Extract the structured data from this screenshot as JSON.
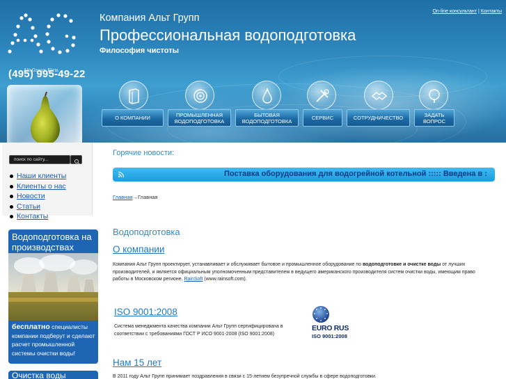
{
  "header": {
    "logo_letters": "AG",
    "logo_subtitle": "Alt Group Firm",
    "phone": "(495) 995-49-22",
    "company_name": "Компания Альт Групп",
    "site_title": "Профессиональная водоподготовка",
    "slogan": "Философия чистоты",
    "top_links": {
      "consultant": "On-line консультант",
      "separator": "|",
      "contacts": "Контакты"
    }
  },
  "nav": {
    "items": [
      {
        "label": "О компании",
        "icon": "book-icon"
      },
      {
        "label": "Промышленная водоподготовка",
        "icon": "disc-icon"
      },
      {
        "label": "Бытовая водоподготовка",
        "icon": "drop-icon"
      },
      {
        "label": "Сервис",
        "icon": "tools-icon"
      },
      {
        "label": "Сотрудничество",
        "icon": "handshake-icon"
      },
      {
        "label": "Задать вопрос",
        "icon": "question-icon"
      }
    ]
  },
  "sidebar": {
    "search_placeholder": "поиск по сайту...",
    "menu": [
      "Наши клиенты",
      "Клиенты о нас",
      "Новости",
      "Статьи",
      "Контакты"
    ],
    "promo": {
      "title": "Водоподготовка на производствах",
      "text_bold": "бесплатно",
      "text_rest": " специалисты компании подберут и сделают расчет промышленной системы очистки воды!"
    },
    "promo2_title": "Очистка воды"
  },
  "main": {
    "hot_news_label": "Горячие новости:",
    "ticker_text": "Поставка оборудования для водогрейной котельной ::::: Введена в :",
    "breadcrumb": {
      "home": "Главная",
      "arrow": "→",
      "current": "Главная"
    },
    "section_title": "Водоподготовка",
    "about": {
      "heading": "О компании",
      "text_1": "Компания Альт Групп проектирует, устанавливает и обслуживает бытовое и промышленное оборудование по ",
      "text_bold": "водоподготовке и очистке воды",
      "text_2": " от лучших производителей, и является официальным уполномоченным представителем в ведущего американского производителя систем очистки воды, имеющим право работы в Московском регионе. ",
      "link": "RainSoft",
      "text_3": " (www.rainsoft.com)."
    },
    "iso": {
      "heading": "ISO 9001:2008",
      "text": "Система менеджмента качества компании Альт Групп сертифицирована в соответствии с требованиями ГОСТ Р ИСО 9001-2008 (ISO 9001:2008)",
      "badge_brand": "EURO RUS",
      "badge_standard": "ISO 9001:2008"
    },
    "years": {
      "heading": "Нам 15 лет",
      "text": "В 2011 году Альт Групп принимает поздравления в связи с 15-летием безупречной службы в сфере водоподготовки."
    }
  },
  "colors": {
    "accent": "#2e8bc9",
    "link": "#1659b8",
    "promo": "#1e66b4",
    "ticker": "#17a0e0"
  }
}
